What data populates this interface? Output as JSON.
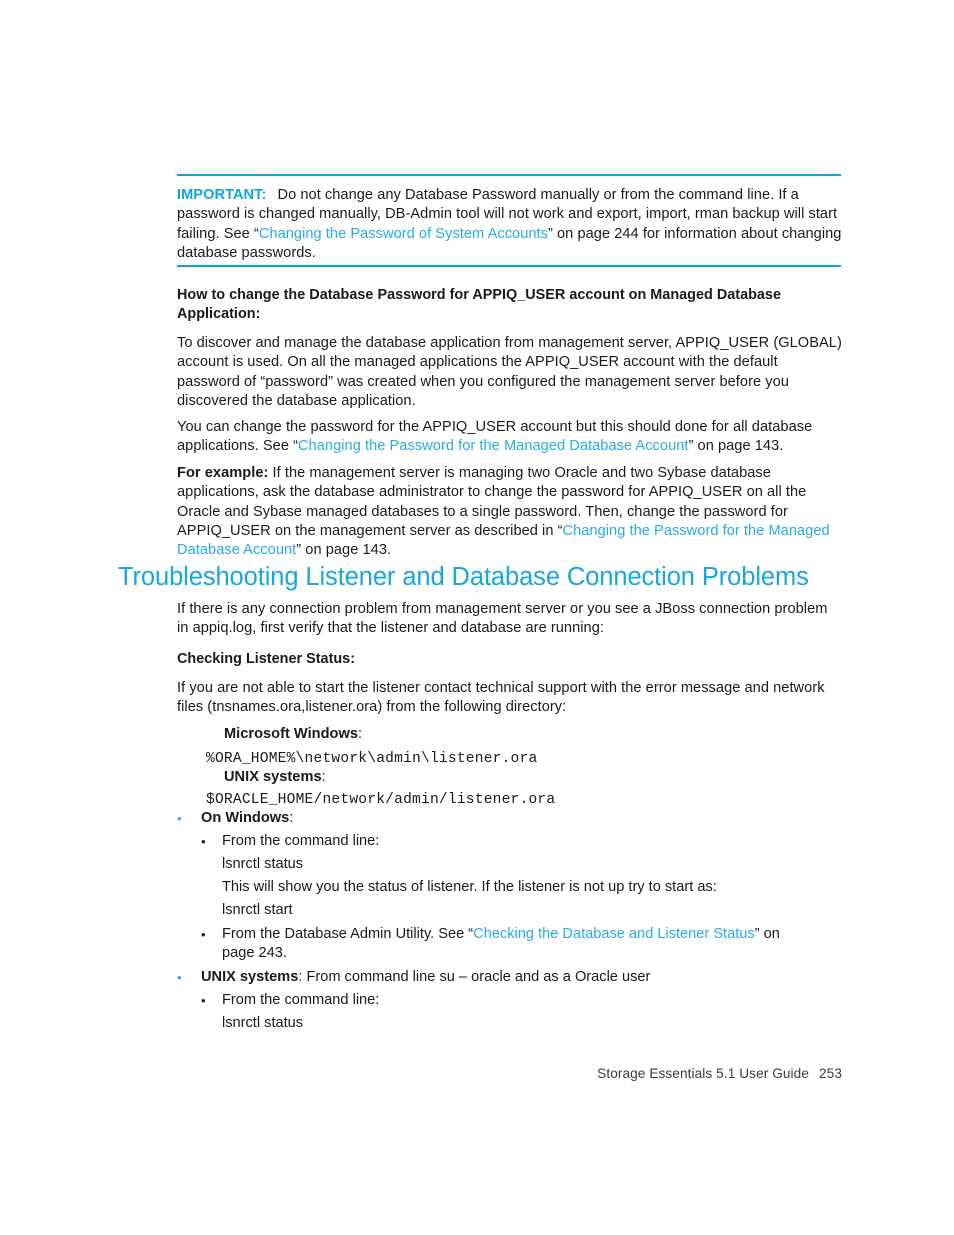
{
  "colors": {
    "accent": "#0fa5dd",
    "link": "#29abe2",
    "heading": "#16a6e0",
    "rule": "#0e9fd8",
    "text": "#1a1a1a"
  },
  "note": {
    "label": "IMPORTANT:",
    "text_before_link": "Do not change any Database Password manually or from the command line. If a password is changed manually, DB-Admin tool will not work and export, import, rman backup will start failing. See “",
    "link": "Changing the Password of System Accounts",
    "text_after_link": "” on page 244 for information about changing database passwords."
  },
  "section_appiq": {
    "subhead": "How to change the Database Password for APPIQ_USER account on Managed Database Application:",
    "para1": "To discover and manage the database application from management server, APPIQ_USER (GLOBAL) account is used. On all the managed applications the APPIQ_USER account with the default password of “password” was created when you configured the management server before you discovered the database application.",
    "para2_before_link": "You can change the password for the APPIQ_USER account but this should done for all database applications. See “",
    "para2_link": "Changing the Password for the Managed Database Account",
    "para2_after_link": "” on page 143.",
    "example_label": "For example:",
    "example_before_link": " If the management server is managing two Oracle and two Sybase database applications, ask the database administrator to change the password for APPIQ_USER on all the Oracle and Sybase managed databases to a single password. Then, change the password for APPIQ_USER on the management server as described in “",
    "example_link": "Changing the Password for the Managed Database Account",
    "example_after_link": "” on page 143."
  },
  "chapter": {
    "title": "Troubleshooting Listener and Database Connection Problems",
    "intro": "If there is any connection problem from management server or you see a JBoss connection problem in appiq.log, first verify that the listener and database are running:"
  },
  "listener": {
    "subhead": "Checking Listener Status:",
    "para": "If you are not able to start the listener contact technical support with the error message and network files (tnsnames.ora,listener.ora) from the following directory:",
    "windows_label": "Microsoft Windows",
    "windows_label_colon": ":",
    "windows_path": "%ORA_HOME%\\network\\admin\\listener.ora",
    "unix_label": "UNIX systems",
    "unix_label_colon": ":",
    "unix_path": "$ORACLE_HOME/network/admin/listener.ora"
  },
  "bullets": {
    "on_windows_label": "On Windows",
    "on_windows_colon": ":",
    "cmd_line_1": "From the command line:",
    "lsnrctl_status_1": "lsnrctl status",
    "status_note": "This will show you the status of listener. If the listener is not up try to start as:",
    "lsnrctl_start": "lsnrctl start",
    "db_admin_before_link": "From the Database Admin Utility. See “",
    "db_admin_link": "Checking the Database and Listener Status",
    "db_admin_after_link": "” on page 243.",
    "unix_label": "UNIX systems",
    "unix_rest": ": From command line su – oracle and as a Oracle user",
    "cmd_line_2": "From the command line:",
    "lsnrctl_status_2": "lsnrctl status",
    "bullet_glyph": "•"
  },
  "footer": {
    "guide": "Storage Essentials 5.1 User Guide",
    "page": "253"
  }
}
